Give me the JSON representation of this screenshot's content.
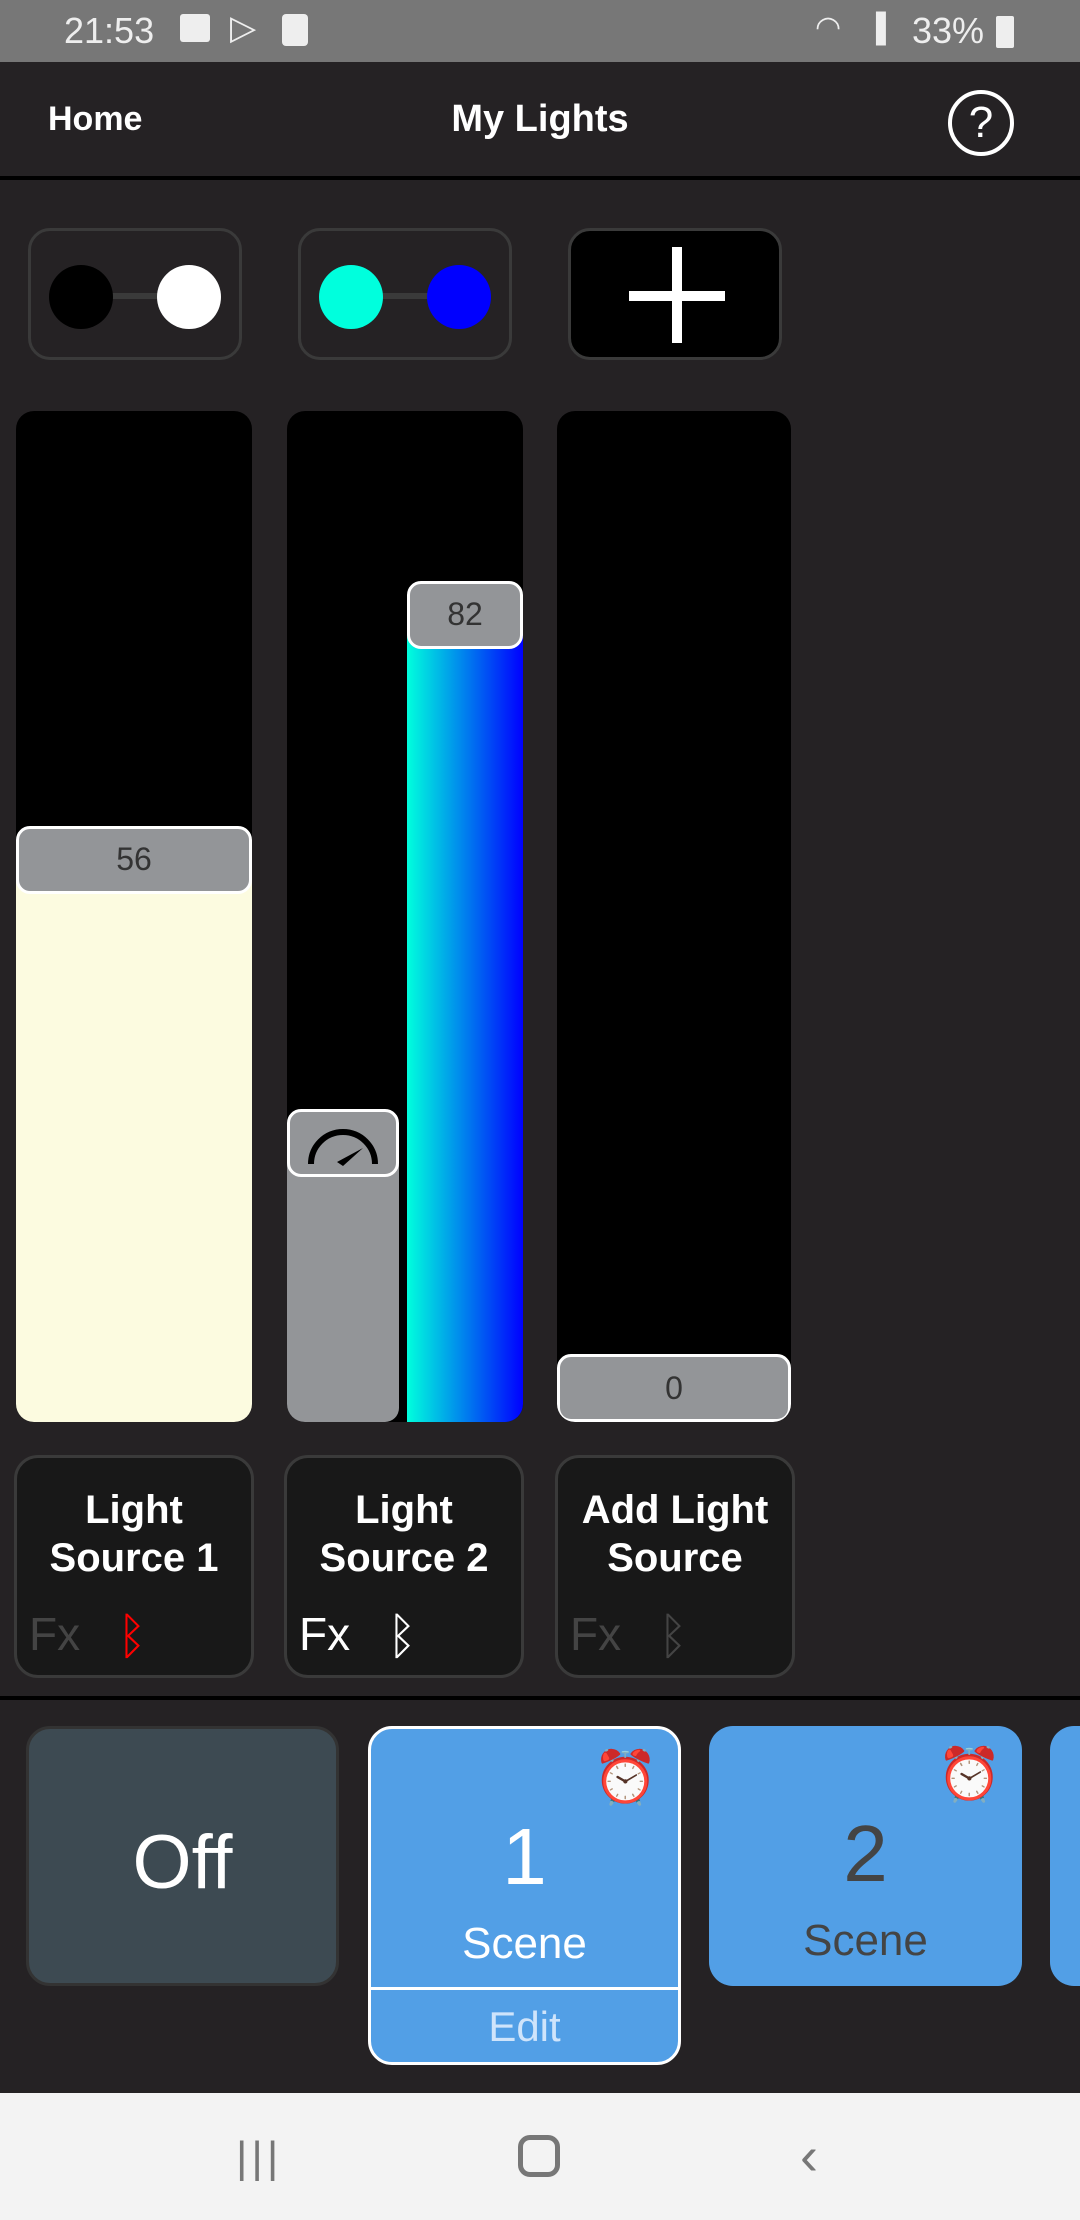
{
  "status_bar": {
    "time": "21:53",
    "battery": "33%",
    "icons": [
      "gallery-icon",
      "play-store-icon",
      "clock-app-icon",
      "wifi-icon",
      "signal-icon",
      "battery-icon"
    ]
  },
  "header": {
    "home": "Home",
    "title": "My Lights",
    "help_icon": "help-circle-icon"
  },
  "swatches": [
    {
      "colors": [
        "#000000",
        "#ffffff"
      ]
    },
    {
      "colors": [
        "#00ffdd",
        "#0000ff"
      ]
    },
    {
      "icon": "plus-icon"
    }
  ],
  "sliders": [
    {
      "value": "56",
      "fill_color": "#fcfbe0"
    },
    {
      "value": "82",
      "gradient": [
        "#00ffdd",
        "#0000ff"
      ],
      "speed_level_percent": 26,
      "speed_icon": "speedometer-icon"
    },
    {
      "value": "0"
    }
  ],
  "light_sources": [
    {
      "name_line1": "Light",
      "name_line2": "Source 1",
      "fx": "Fx",
      "bluetooth_color": "#ff0000",
      "fx_color": "#444444"
    },
    {
      "name_line1": "Light",
      "name_line2": "Source 2",
      "fx": "Fx",
      "bluetooth_color": "#ffffff",
      "fx_color": "#ffffff"
    },
    {
      "name_line1": "Add Light",
      "name_line2": "Source",
      "fx": "Fx",
      "bluetooth_color": "#444444",
      "fx_color": "#444444"
    }
  ],
  "scenes": {
    "off": "Off",
    "items": [
      {
        "number": "1",
        "label": "Scene",
        "edit": "Edit",
        "selected": true,
        "icon": "alarm-clock-icon"
      },
      {
        "number": "2",
        "label": "Scene",
        "selected": false,
        "icon": "alarm-clock-icon"
      }
    ]
  },
  "colors": {
    "accent": "#529fe6",
    "off_button": "#3d4a52",
    "background": "#252224"
  }
}
